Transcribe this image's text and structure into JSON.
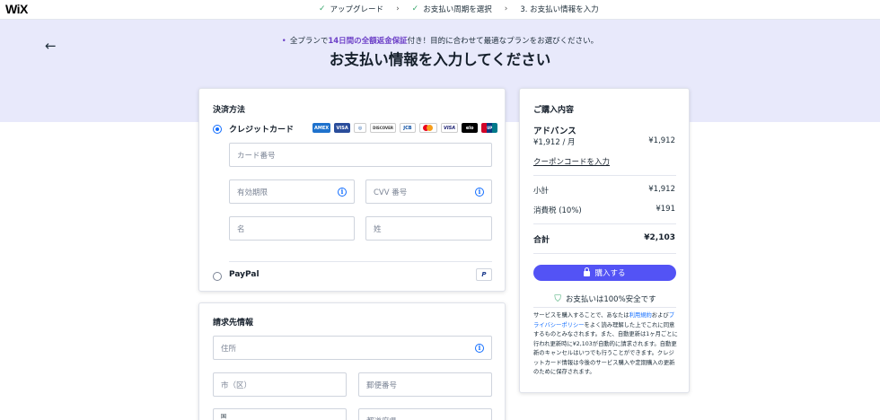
{
  "brand": {
    "logo": "WiX"
  },
  "steps": [
    {
      "label": "アップグレード",
      "done": true
    },
    {
      "label": "お支払い周期を選択",
      "done": true
    },
    {
      "label": "3.  お支払い情報を入力",
      "done": false
    }
  ],
  "hero": {
    "promo_prefix": "全プランで",
    "promo_highlight": "14日間の全額返金保証",
    "promo_suffix": "付き！目的に合わせて最適なプランをお選びください。",
    "title": "お支払い情報を入力してください"
  },
  "payment": {
    "title": "決済方法",
    "credit_label": "クレジットカード",
    "brands": [
      "AMEX",
      "VISA",
      "Diners",
      "DISCOVER",
      "JCB",
      "MC",
      "VISA",
      "elo",
      "UnionPay"
    ],
    "card_number_placeholder": "カード番号",
    "expiry_placeholder": "有効期限",
    "cvv_placeholder": "CVV 番号",
    "first_name_placeholder": "名",
    "last_name_placeholder": "姓",
    "paypal_label": "PayPal",
    "paypal_icon": "P"
  },
  "billing": {
    "title": "請求先情報",
    "address_placeholder": "住所",
    "city_placeholder": "市（区）",
    "zip_placeholder": "郵便番号",
    "country_label": "国",
    "prefecture_placeholder": "都道府県"
  },
  "summary": {
    "title": "ご購入内容",
    "plan_name": "アドバンス",
    "plan_price": "¥1,912 / 月",
    "plan_total": "¥1,912",
    "coupon_link": "クーポンコードを入力",
    "subtotal_label": "小計",
    "subtotal_value": "¥1,912",
    "tax_label": "消費税 (10%)",
    "tax_value": "¥191",
    "total_label": "合計",
    "total_value": "¥2,103",
    "buy_button": "購入する",
    "secure_text": "お支払いは100%安全です",
    "legal_1": "サービスを購入することで、あなたは",
    "legal_terms": "利用規約",
    "legal_2": "および",
    "legal_privacy": "プライバシーポリシー",
    "legal_3": "をよく読み理解した上でこれに同意するものとみなされます。また、自動更新は1ヶ月ごとに行われ更新時に¥2,103が自動的に請求されます。自動更新のキャンセルはいつでも行うことができます。クレジットカード情報は今後のサービス購入や定期購入の更新のために保存されます。"
  },
  "colors": {
    "accent": "#5353f5",
    "link": "#116dff",
    "hero_bg": "#e8e9fb",
    "check": "#3aa76d",
    "promo": "#6c3fc7"
  }
}
